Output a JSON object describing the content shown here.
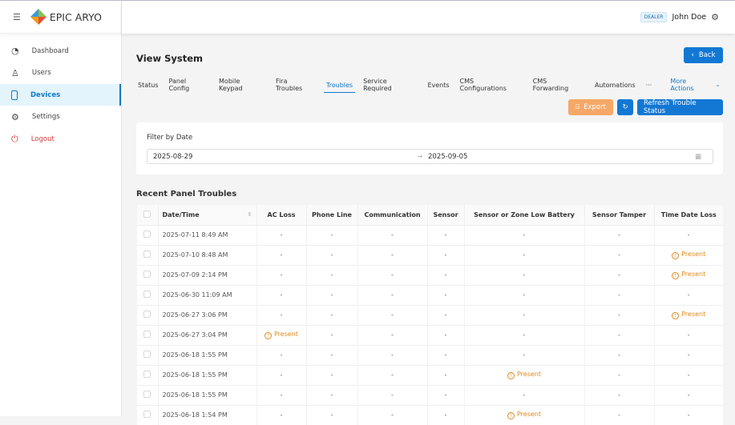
{
  "brand": {
    "name": "EPIC ARYO"
  },
  "sidebar": {
    "items": [
      {
        "label": "Dashboard",
        "icon": "gauge-icon"
      },
      {
        "label": "Users",
        "icon": "user-icon"
      },
      {
        "label": "Devices",
        "icon": "tablet-icon"
      },
      {
        "label": "Settings",
        "icon": "gear-icon"
      },
      {
        "label": "Logout",
        "icon": "logout-icon"
      }
    ]
  },
  "header": {
    "role_badge": "DEALER",
    "user_name": "John Doe"
  },
  "page": {
    "title": "View System",
    "back_label": "Back"
  },
  "tabs": [
    "Status",
    "Panel Config",
    "Mobile Keypad",
    "Fira Troubles",
    "Troubles",
    "Service Required",
    "Events",
    "CMS Configurations",
    "CMS Forwarding",
    "Automations"
  ],
  "tabs_overflow": "···",
  "more_actions": "More Actions",
  "actions": {
    "export": "Export",
    "refresh": "Refresh Trouble Status"
  },
  "filter": {
    "label": "Filter by Date",
    "start": "2025-08-29",
    "end": "2025-09-05",
    "separator": "→"
  },
  "section_title": "Recent Panel Troubles",
  "colors": {
    "primary": "#1278d4",
    "export": "#f5a867",
    "present": "#e08a1e",
    "logout": "#d63a3a"
  },
  "table": {
    "columns": [
      "Date/Time",
      "AC Loss",
      "Phone Line",
      "Communication",
      "Sensor",
      "Sensor or Zone Low Battery",
      "Sensor Tamper",
      "Time Date Loss"
    ],
    "rows": [
      [
        "2025-07-11 8:49 AM",
        "-",
        "-",
        "-",
        "-",
        "-",
        "-",
        "-"
      ],
      [
        "2025-07-10 8:48 AM",
        "-",
        "-",
        "-",
        "-",
        "-",
        "-",
        "Present"
      ],
      [
        "2025-07-09 2:14 PM",
        "-",
        "-",
        "-",
        "-",
        "-",
        "-",
        "Present"
      ],
      [
        "2025-06-30 11:09 AM",
        "-",
        "-",
        "-",
        "-",
        "-",
        "-",
        "-"
      ],
      [
        "2025-06-27 3:06 PM",
        "-",
        "-",
        "-",
        "-",
        "-",
        "-",
        "Present"
      ],
      [
        "2025-06-27 3:04 PM",
        "Present",
        "-",
        "-",
        "-",
        "-",
        "-",
        "-"
      ],
      [
        "2025-06-18 1:55 PM",
        "-",
        "-",
        "-",
        "-",
        "-",
        "-",
        "-"
      ],
      [
        "2025-06-18 1:55 PM",
        "-",
        "-",
        "-",
        "-",
        "Present",
        "-",
        "-"
      ],
      [
        "2025-06-18 1:55 PM",
        "-",
        "-",
        "-",
        "-",
        "-",
        "-",
        "-"
      ],
      [
        "2025-06-18 1:54 PM",
        "-",
        "-",
        "-",
        "-",
        "Present",
        "-",
        "-"
      ]
    ]
  }
}
